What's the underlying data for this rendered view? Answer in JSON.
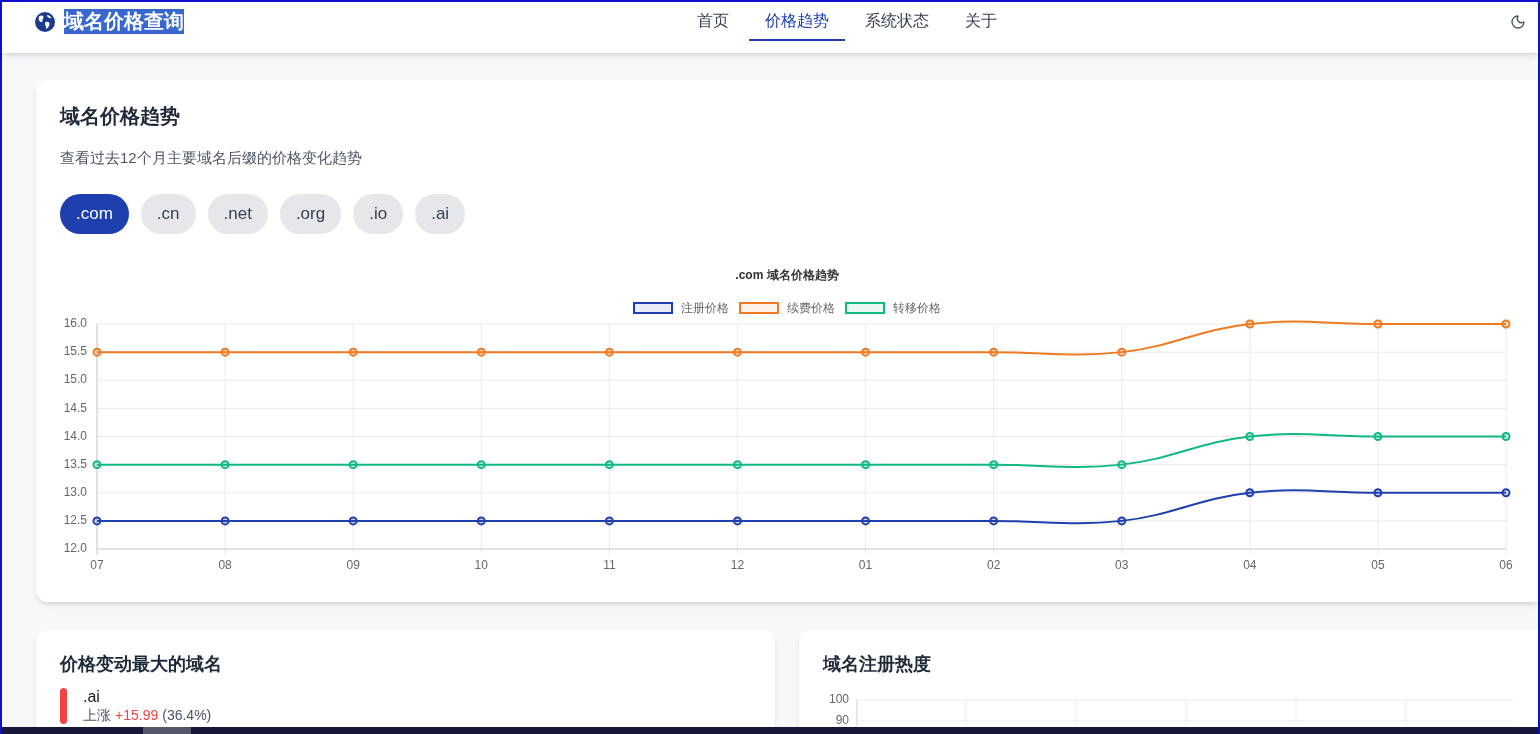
{
  "header": {
    "logo": {
      "text": "域名价格查询",
      "highlighted": true
    },
    "nav": [
      {
        "label": "首页",
        "selected": false
      },
      {
        "label": "价格趋势",
        "selected": true
      },
      {
        "label": "系统状态",
        "selected": false
      },
      {
        "label": "关于",
        "selected": false
      }
    ]
  },
  "trend_card": {
    "title": "域名价格趋势",
    "subtitle": "查看过去12个月主要域名后缀的价格变化趋势",
    "tlds": [
      {
        "label": ".com",
        "selected": true
      },
      {
        "label": ".cn",
        "selected": false
      },
      {
        "label": ".net",
        "selected": false
      },
      {
        "label": ".org",
        "selected": false
      },
      {
        "label": ".io",
        "selected": false
      },
      {
        "label": ".ai",
        "selected": false
      }
    ],
    "chart_data": {
      "type": "line",
      "title": ".com 域名价格趋势",
      "legend": true,
      "grid": true,
      "categories": [
        "07",
        "08",
        "09",
        "10",
        "11",
        "12",
        "01",
        "02",
        "03",
        "04",
        "05",
        "06"
      ],
      "series": [
        {
          "name": "注册价格",
          "color": "#1e40af",
          "marker": "circle",
          "values": [
            12.5,
            12.5,
            12.5,
            12.5,
            12.5,
            12.5,
            12.5,
            12.5,
            12.5,
            13,
            13,
            13
          ]
        },
        {
          "name": "续费价格",
          "color": "#f07a22",
          "marker": "circle",
          "values": [
            15.5,
            15.5,
            15.5,
            15.5,
            15.5,
            15.5,
            15.5,
            15.5,
            15.5,
            16,
            16,
            16
          ]
        },
        {
          "name": "转移价格",
          "color": "#10b981",
          "marker": "circle",
          "values": [
            13.5,
            13.5,
            13.5,
            13.5,
            13.5,
            13.5,
            13.5,
            13.5,
            13.5,
            14,
            14,
            14
          ]
        }
      ],
      "ylim": [
        12,
        16
      ],
      "yticks": [
        {
          "value": 12,
          "label": "12.0"
        },
        {
          "value": 12.5,
          "label": "12.5"
        },
        {
          "value": 13,
          "label": "13.0"
        },
        {
          "value": 13.5,
          "label": "13.5"
        },
        {
          "value": 14,
          "label": "14.0"
        },
        {
          "value": 14.5,
          "label": "14.5"
        },
        {
          "value": 15,
          "label": "15.0"
        },
        {
          "value": 15.5,
          "label": "15.5"
        },
        {
          "value": 16,
          "label": "16.0"
        }
      ]
    }
  },
  "changes_card": {
    "title": "价格变动最大的域名",
    "items": [
      {
        "domain": ".ai",
        "direction": "上涨",
        "change": "+15.99",
        "percent": "(36.4%)",
        "color": "#ef4444"
      }
    ]
  },
  "popularity_card": {
    "title": "域名注册热度",
    "y_axis_labels": [
      "100",
      "90"
    ]
  }
}
